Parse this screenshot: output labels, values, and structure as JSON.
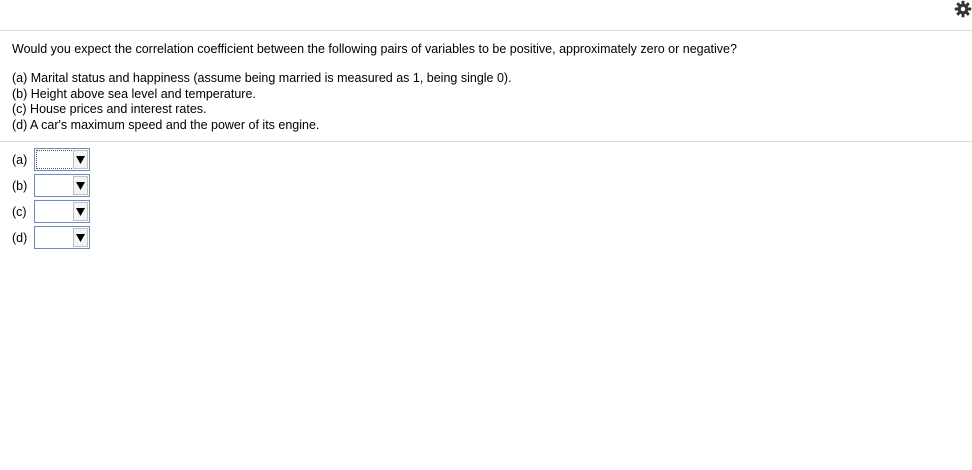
{
  "settings_icon": "gear-icon",
  "question": "Would you expect the correlation coefficient between the following pairs of variables to be positive, approximately zero or negative?",
  "items": [
    "(a) Marital status and happiness (assume being married is measured as 1, being single 0).",
    "(b) Height above sea level and temperature.",
    "(c) House prices and interest rates.",
    "(d) A car's maximum speed and the power of its engine."
  ],
  "answers": [
    {
      "label": "(a)",
      "value": ""
    },
    {
      "label": "(b)",
      "value": ""
    },
    {
      "label": "(c)",
      "value": ""
    },
    {
      "label": "(d)",
      "value": ""
    }
  ],
  "colors": {
    "dropdown_border": "#6c8cc8",
    "rule": "#d9d9d9"
  }
}
